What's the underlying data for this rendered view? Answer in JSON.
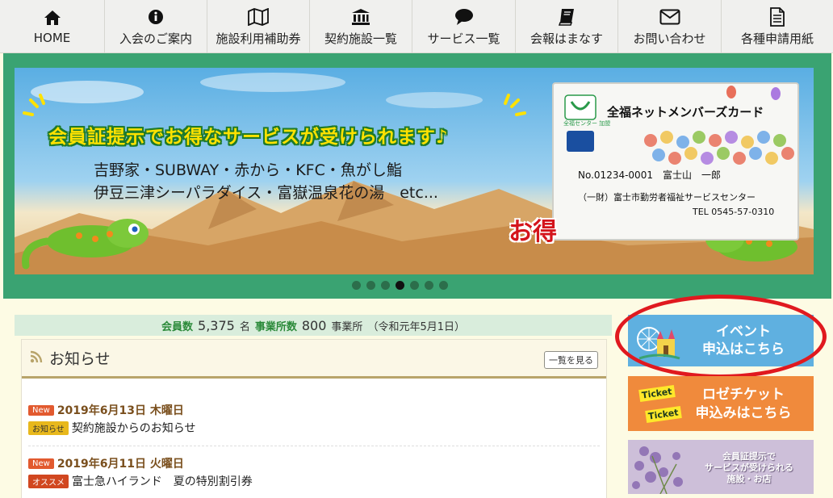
{
  "nav": {
    "items": [
      {
        "label": "HOME",
        "icon": "home-icon"
      },
      {
        "label": "入会のご案内",
        "icon": "info-icon"
      },
      {
        "label": "施設利用補助券",
        "icon": "map-icon"
      },
      {
        "label": "契約施設一覧",
        "icon": "bank-icon"
      },
      {
        "label": "サービス一覧",
        "icon": "chat-icon"
      },
      {
        "label": "会報はまなす",
        "icon": "book-icon"
      },
      {
        "label": "お問い合わせ",
        "icon": "mail-icon"
      },
      {
        "label": "各種申請用紙",
        "icon": "document-icon"
      }
    ]
  },
  "banner": {
    "headline": "会員証提示でお得なサービスが受けられます♪",
    "line1": "吉野家・SUBWAY・赤から・KFC・魚がし鮨",
    "line2": "伊豆三津シーパラダイス・富嶽温泉花の湯　etc...",
    "badge": "お得",
    "card": {
      "title": "全福ネットメンバーズカード",
      "logo_text": "全福センター 加盟",
      "number_line": "No.01234-0001　富士山　一郎",
      "org_line": "（一財）富士市勤労者福祉サービスセンター",
      "tel_line": "TEL 0545-57-0310"
    },
    "slide_count": 7,
    "active_slide": 4
  },
  "members": {
    "label_members": "会員数",
    "members_count": "5,375",
    "unit_members": "名",
    "label_offices": "事業所数",
    "offices_count": "800",
    "unit_offices": "事業所",
    "as_of": "（令和元年5月1日）"
  },
  "news": {
    "title": "お知らせ",
    "more_label": "一覧を見る",
    "items": [
      {
        "badge_new": "New",
        "date": "2019年6月13日 木曜日",
        "category": "お知らせ",
        "text": "契約施設からのお知らせ"
      },
      {
        "badge_new": "New",
        "date": "2019年6月11日 火曜日",
        "category": "オススメ",
        "text": "富士急ハイランド　夏の特別割引券"
      }
    ]
  },
  "side": {
    "event_line1": "イベント",
    "event_line2": "申込はこちら",
    "ticket_line1": "ロゼチケット",
    "ticket_line2": "申込みはこちら",
    "ticket_tag1": "Ticket",
    "ticket_tag2": "Ticket",
    "shop_line1": "会員証提示で",
    "shop_line2": "サービスが受けられる",
    "shop_line3": "施設・お店"
  },
  "colors": {
    "frame_green": "#3aa372",
    "event_blue": "#5fb0e0",
    "ticket_orange": "#f08a3c",
    "highlight_red": "#e0191f"
  }
}
